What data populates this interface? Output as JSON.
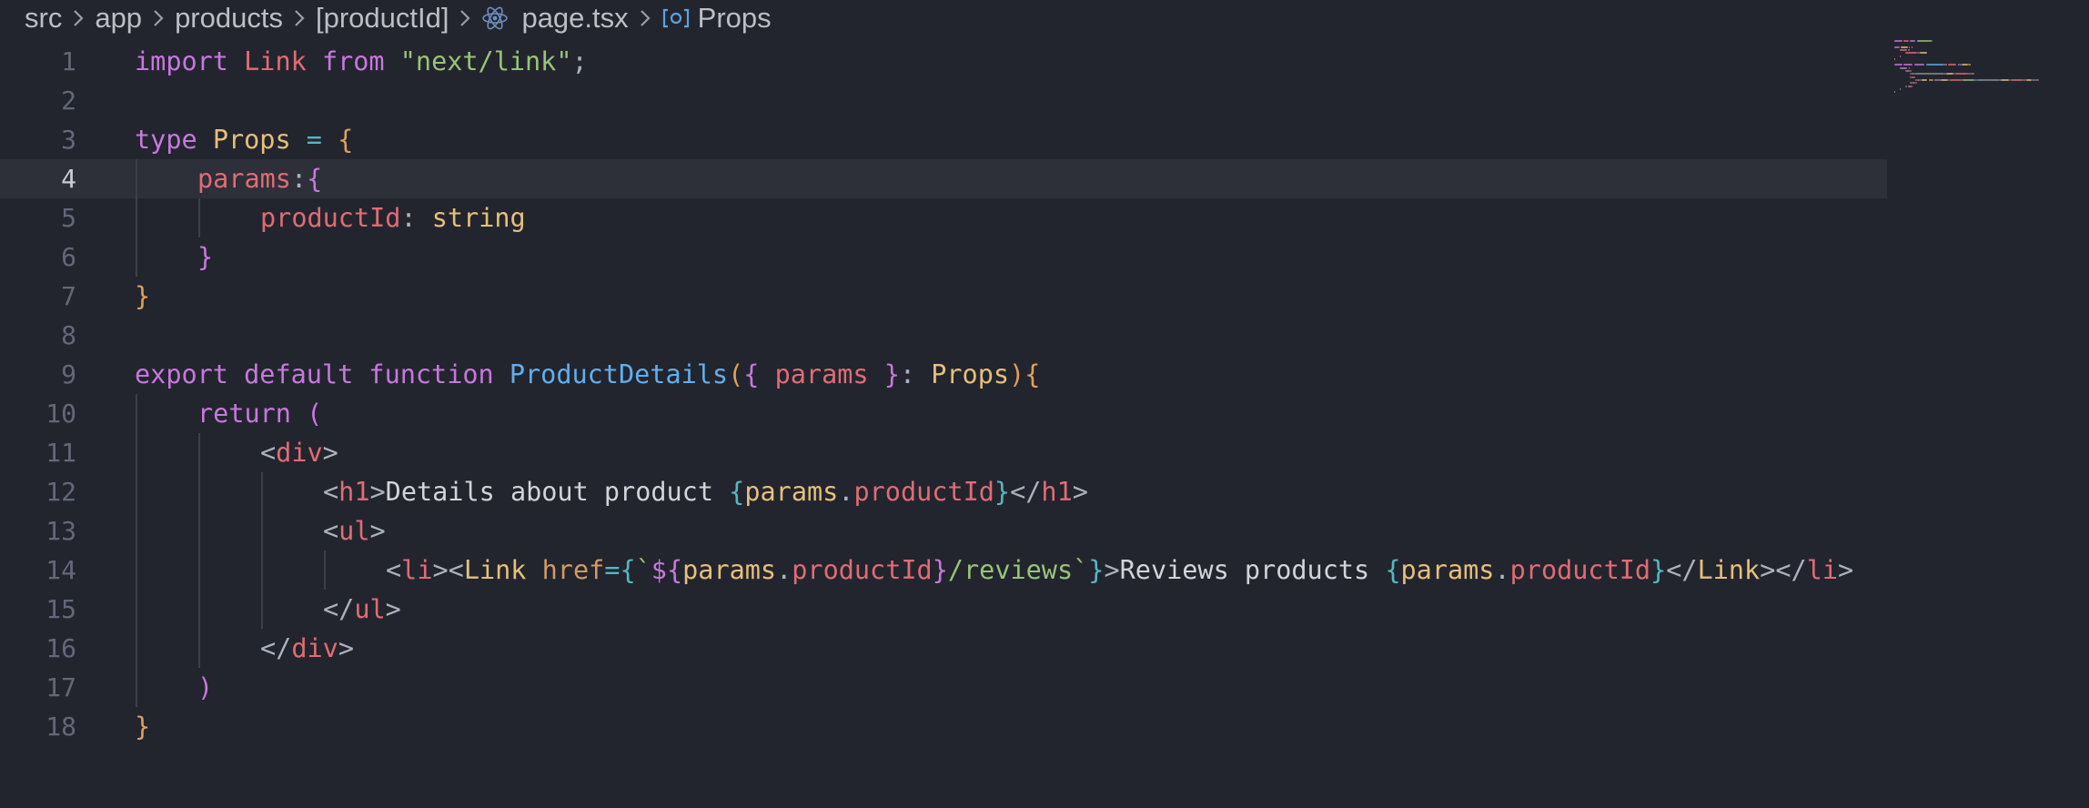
{
  "breadcrumb": {
    "items": [
      {
        "label": "src"
      },
      {
        "label": "app"
      },
      {
        "label": "products"
      },
      {
        "label": "[productId]"
      },
      {
        "label": "page.tsx",
        "icon": "react-icon"
      },
      {
        "label": "Props",
        "icon": "symbol-interface-icon"
      }
    ]
  },
  "editor": {
    "current_line": 4,
    "lines": [
      {
        "number": "1",
        "indent": 0,
        "tokens": [
          {
            "t": "import",
            "c": "kw"
          },
          {
            "t": " ",
            "c": "text"
          },
          {
            "t": "Link",
            "c": "def"
          },
          {
            "t": " ",
            "c": "text"
          },
          {
            "t": "from",
            "c": "kw"
          },
          {
            "t": " ",
            "c": "text"
          },
          {
            "t": "\"next/link\"",
            "c": "str"
          },
          {
            "t": ";",
            "c": "punc"
          }
        ]
      },
      {
        "number": "2",
        "indent": 0,
        "tokens": []
      },
      {
        "number": "3",
        "indent": 0,
        "tokens": [
          {
            "t": "type",
            "c": "kw"
          },
          {
            "t": " ",
            "c": "text"
          },
          {
            "t": "Props",
            "c": "type"
          },
          {
            "t": " ",
            "c": "text"
          },
          {
            "t": "=",
            "c": "op"
          },
          {
            "t": " ",
            "c": "text"
          },
          {
            "t": "{",
            "c": "brace"
          }
        ]
      },
      {
        "number": "4",
        "indent": 1,
        "tokens": [
          {
            "t": "params",
            "c": "def"
          },
          {
            "t": ":",
            "c": "punc"
          },
          {
            "t": "{",
            "c": "kw"
          }
        ]
      },
      {
        "number": "5",
        "indent": 2,
        "tokens": [
          {
            "t": "productId",
            "c": "def"
          },
          {
            "t": ": ",
            "c": "punc"
          },
          {
            "t": "string",
            "c": "type"
          }
        ]
      },
      {
        "number": "6",
        "indent": 1,
        "tokens": [
          {
            "t": "}",
            "c": "kw"
          }
        ]
      },
      {
        "number": "7",
        "indent": 0,
        "tokens": [
          {
            "t": "}",
            "c": "brace"
          }
        ]
      },
      {
        "number": "8",
        "indent": 0,
        "tokens": []
      },
      {
        "number": "9",
        "indent": 0,
        "tokens": [
          {
            "t": "export",
            "c": "kw"
          },
          {
            "t": " ",
            "c": "text"
          },
          {
            "t": "default",
            "c": "kw"
          },
          {
            "t": " ",
            "c": "text"
          },
          {
            "t": "function",
            "c": "kw"
          },
          {
            "t": " ",
            "c": "text"
          },
          {
            "t": "ProductDetails",
            "c": "fn"
          },
          {
            "t": "(",
            "c": "brace"
          },
          {
            "t": "{",
            "c": "kw"
          },
          {
            "t": " ",
            "c": "text"
          },
          {
            "t": "params",
            "c": "def"
          },
          {
            "t": " ",
            "c": "text"
          },
          {
            "t": "}",
            "c": "kw"
          },
          {
            "t": ": ",
            "c": "punc"
          },
          {
            "t": "Props",
            "c": "type"
          },
          {
            "t": ")",
            "c": "brace"
          },
          {
            "t": "{",
            "c": "brace"
          }
        ]
      },
      {
        "number": "10",
        "indent": 1,
        "tokens": [
          {
            "t": "return",
            "c": "kw"
          },
          {
            "t": " ",
            "c": "text"
          },
          {
            "t": "(",
            "c": "kw"
          }
        ]
      },
      {
        "number": "11",
        "indent": 2,
        "tokens": [
          {
            "t": "<",
            "c": "punc"
          },
          {
            "t": "div",
            "c": "tag"
          },
          {
            "t": ">",
            "c": "punc"
          }
        ]
      },
      {
        "number": "12",
        "indent": 3,
        "tokens": [
          {
            "t": "<",
            "c": "punc"
          },
          {
            "t": "h1",
            "c": "tag"
          },
          {
            "t": ">",
            "c": "punc"
          },
          {
            "t": "Details about product ",
            "c": "text"
          },
          {
            "t": "{",
            "c": "op"
          },
          {
            "t": "params",
            "c": "var"
          },
          {
            "t": ".",
            "c": "punc"
          },
          {
            "t": "productId",
            "c": "def"
          },
          {
            "t": "}",
            "c": "op"
          },
          {
            "t": "</",
            "c": "punc"
          },
          {
            "t": "h1",
            "c": "tag"
          },
          {
            "t": ">",
            "c": "punc"
          }
        ]
      },
      {
        "number": "13",
        "indent": 3,
        "tokens": [
          {
            "t": "<",
            "c": "punc"
          },
          {
            "t": "ul",
            "c": "tag"
          },
          {
            "t": ">",
            "c": "punc"
          }
        ]
      },
      {
        "number": "14",
        "indent": 4,
        "tokens": [
          {
            "t": "<",
            "c": "punc"
          },
          {
            "t": "li",
            "c": "tag"
          },
          {
            "t": "><",
            "c": "punc"
          },
          {
            "t": "Link",
            "c": "type"
          },
          {
            "t": " ",
            "c": "text"
          },
          {
            "t": "href",
            "c": "attr"
          },
          {
            "t": "=",
            "c": "op"
          },
          {
            "t": "{",
            "c": "op"
          },
          {
            "t": "`",
            "c": "str"
          },
          {
            "t": "${",
            "c": "kw"
          },
          {
            "t": "params",
            "c": "var"
          },
          {
            "t": ".",
            "c": "punc"
          },
          {
            "t": "productId",
            "c": "def"
          },
          {
            "t": "}",
            "c": "kw"
          },
          {
            "t": "/reviews`",
            "c": "str"
          },
          {
            "t": "}",
            "c": "op"
          },
          {
            "t": ">",
            "c": "punc"
          },
          {
            "t": "Reviews products ",
            "c": "text"
          },
          {
            "t": "{",
            "c": "op"
          },
          {
            "t": "params",
            "c": "var"
          },
          {
            "t": ".",
            "c": "punc"
          },
          {
            "t": "productId",
            "c": "def"
          },
          {
            "t": "}",
            "c": "op"
          },
          {
            "t": "</",
            "c": "punc"
          },
          {
            "t": "Link",
            "c": "type"
          },
          {
            "t": "></",
            "c": "punc"
          },
          {
            "t": "li",
            "c": "tag"
          },
          {
            "t": ">",
            "c": "punc"
          }
        ]
      },
      {
        "number": "15",
        "indent": 3,
        "tokens": [
          {
            "t": "</",
            "c": "punc"
          },
          {
            "t": "ul",
            "c": "tag"
          },
          {
            "t": ">",
            "c": "punc"
          }
        ]
      },
      {
        "number": "16",
        "indent": 2,
        "tokens": [
          {
            "t": "</",
            "c": "punc"
          },
          {
            "t": "div",
            "c": "tag"
          },
          {
            "t": ">",
            "c": "punc"
          }
        ]
      },
      {
        "number": "17",
        "indent": 1,
        "tokens": [
          {
            "t": ")",
            "c": "kw"
          }
        ]
      },
      {
        "number": "18",
        "indent": 0,
        "tokens": [
          {
            "t": "}",
            "c": "brace"
          }
        ]
      }
    ]
  },
  "colors": {
    "background": "#23252e",
    "current_line": "#2d2f39",
    "keyword": "#c678dd",
    "identifier": "#e06c75",
    "string": "#98c379",
    "type": "#e5c07b",
    "function": "#61afef",
    "operator": "#56b6c2",
    "brace": "#e0a05a"
  }
}
